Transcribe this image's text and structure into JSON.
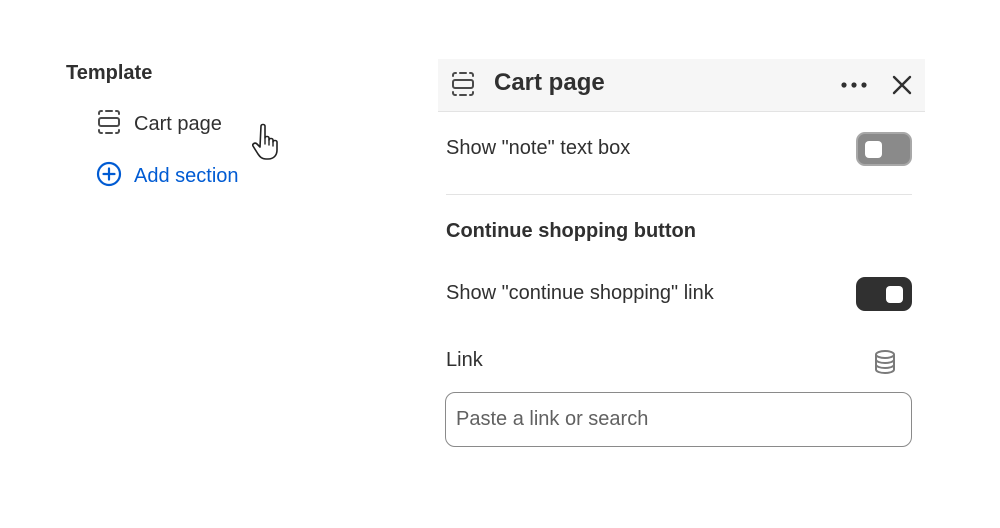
{
  "template_tree": {
    "heading": "Template",
    "items": [
      {
        "label": "Cart page",
        "icon": "section-icon"
      }
    ],
    "add_section_label": "Add section",
    "accent_color": "#005bd3"
  },
  "panel": {
    "title": "Cart page",
    "header_icons": [
      "section-icon",
      "more-horizontal-icon",
      "close-icon"
    ],
    "settings": {
      "note_label": "Show \"note\" text box",
      "note_enabled": false,
      "continue_heading": "Continue shopping button",
      "continue_label": "Show \"continue shopping\" link",
      "continue_enabled": true,
      "link_label": "Link",
      "link_placeholder": "Paste a link or search",
      "link_value": ""
    }
  }
}
